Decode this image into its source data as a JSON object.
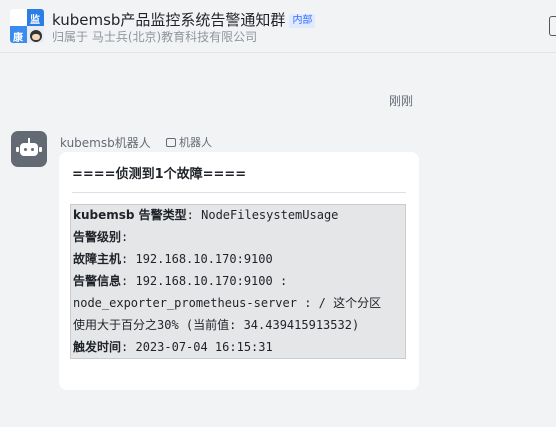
{
  "header": {
    "title": "kubemsb产品监控系统告警通知群",
    "internal_tag": "内部",
    "org": "归属于 马士兵(北京)教育科技有限公司",
    "avatar_chars": [
      "监",
      "康"
    ]
  },
  "timestamp": "刚刚",
  "message": {
    "sender": "kubemsb机器人",
    "bot_badge": "机器人",
    "title": "====侦测到1个故障====",
    "lines": [
      {
        "label": "kubemsb 告警类型",
        "value": ": NodeFilesystemUsage"
      },
      {
        "label": "告警级别",
        "value": ":"
      },
      {
        "label": "故障主机",
        "value": ": 192.168.10.170:9100"
      },
      {
        "label": "告警信息",
        "value": ": 192.168.10.170:9100 :"
      },
      {
        "label": "",
        "value": "node_exporter_prometheus-server : / 这个分区"
      },
      {
        "label": "",
        "value": "使用大于百分之30% (当前值: 34.439415913532)"
      },
      {
        "label": "触发时间",
        "value": ": 2023-07-04 16:15:31"
      }
    ]
  }
}
